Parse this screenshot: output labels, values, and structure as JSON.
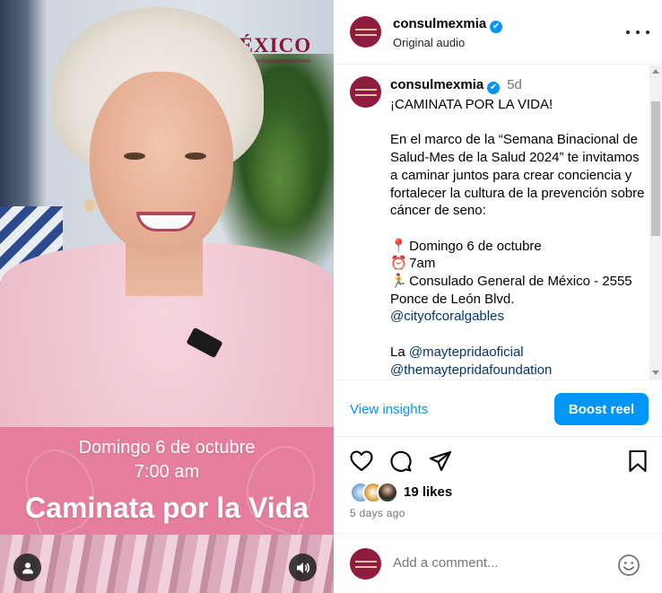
{
  "video": {
    "logo_text": "MÉXICO",
    "overlay_line1": "Domingo 6 de octubre",
    "overlay_line2": "7:00 am",
    "overlay_title": "Caminata por la Vida",
    "user_icon": "user-icon",
    "sound_icon": "speaker-icon"
  },
  "header": {
    "username": "consulmexmia",
    "verified": "✔",
    "audio": "Original audio",
    "more_icon": "more-options-icon"
  },
  "caption": {
    "username": "consulmexmia",
    "verified": "✔",
    "time": "5d",
    "line_title": "¡CAMINATA POR LA VIDA!",
    "paragraph": "En el marco de la “Semana Binacional de Salud-Mes de la Salud 2024” te invitamos a caminar juntos para crear conciencia y fortalecer la cultura de la prevención sobre cáncer de seno:",
    "date_emoji": "📍",
    "date": "Domingo 6 de octubre",
    "time_emoji": "⏰",
    "time_value": "7am",
    "place_emoji": "🏃",
    "place": "Consulado General de México - 2555 Ponce de León Blvd.",
    "mention_city": "@cityofcoralgables",
    "la": "La",
    "mention_maytepridaoficial": "@maytepridaoficial",
    "mention_foundation": "@themaytepridafoundation"
  },
  "insights": {
    "view_label": "View insights",
    "boost_label": "Boost reel"
  },
  "actions": {
    "like_icon": "heart-icon",
    "comment_icon": "comment-icon",
    "share_icon": "share-icon",
    "save_icon": "bookmark-icon"
  },
  "likes": {
    "count_text": "19 likes",
    "ago": "5 days ago"
  },
  "comment": {
    "placeholder": "Add a comment...",
    "emoji_icon": "smiley-icon"
  },
  "colors": {
    "accent": "#0095f6",
    "brand": "#8a1538",
    "mention": "#00376b",
    "overlay": "#e47396"
  }
}
